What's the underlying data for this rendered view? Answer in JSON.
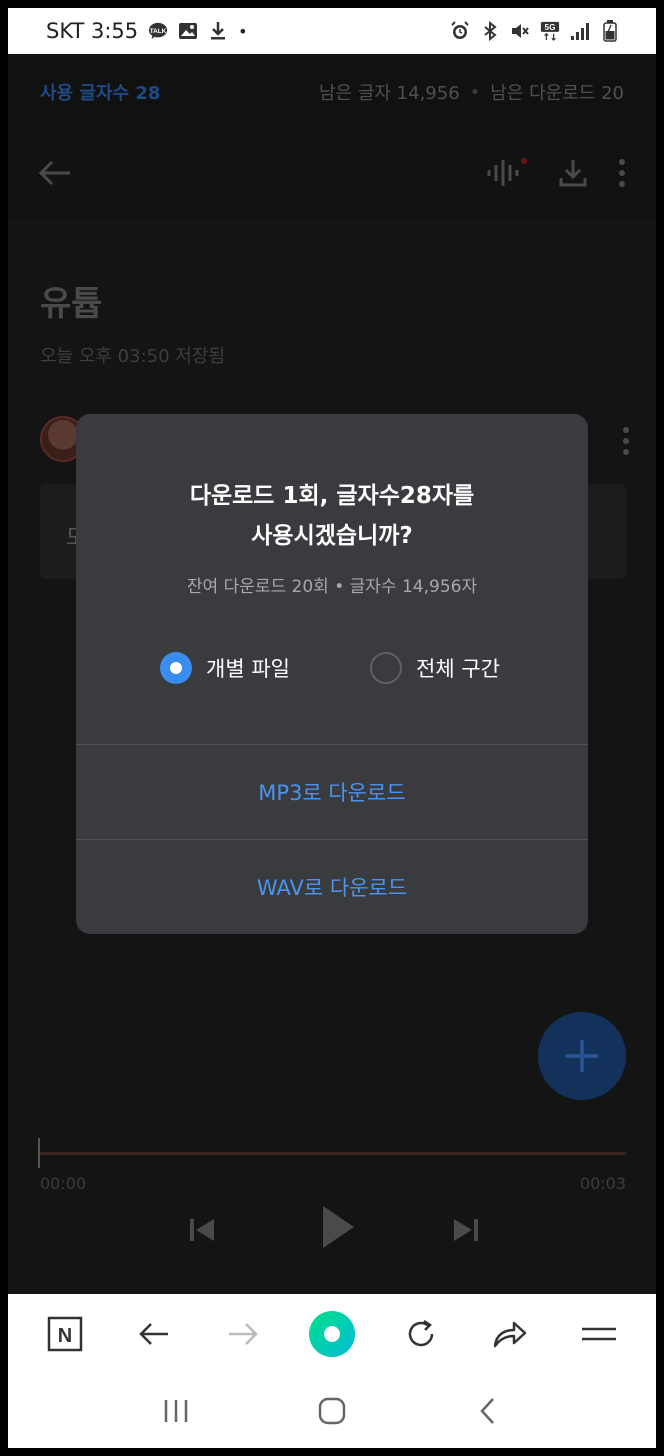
{
  "status_bar": {
    "carrier_time": "SKT 3:55",
    "talk_badge": "TALK",
    "network_badge": "5G",
    "dot": "•",
    "icons_left": [
      "talk-icon",
      "image-icon",
      "download-icon"
    ],
    "icons_right": [
      "alarm-icon",
      "bluetooth-icon",
      "mute-icon",
      "5g-icon",
      "signal-icon",
      "battery-icon"
    ]
  },
  "usage": {
    "used_chars": "사용 글자수 28",
    "remaining_chars": "남은 글자 14,956",
    "separator": "•",
    "remaining_downloads": "남은 다운로드 20"
  },
  "document": {
    "title": "유튭",
    "saved_time": "오늘 오후 03:50 저장됨",
    "bubble_text": "모"
  },
  "player": {
    "time_start": "00:00",
    "time_end": "00:03"
  },
  "dialog": {
    "title_line1": "다운로드 1회, 글자수28자를",
    "title_line2": "사용시겠습니까?",
    "subtitle": "잔여 다운로드 20회 • 글자수 14,956자",
    "option_individual": "개별 파일",
    "option_whole": "전체 구간",
    "selected_option": "개별 파일",
    "mp3_button": "MP3로 다운로드",
    "wav_button": "WAV로 다운로드"
  },
  "colors": {
    "accent": "#3a8dee",
    "dialog_bg": "#3a3b3f",
    "link": "#4b93ef",
    "browser_dot_gradient_start": "#00e08a",
    "browser_dot_gradient_end": "#00bcd4"
  },
  "browser_bar": {
    "items": [
      "naver-n-icon",
      "back-arrow-icon",
      "forward-arrow-icon",
      "green-dot-icon",
      "refresh-icon",
      "share-icon",
      "menu-icon"
    ],
    "n_letter": "N"
  },
  "nav_bar": {
    "items": [
      "recent-apps-icon",
      "home-icon",
      "back-icon"
    ]
  }
}
